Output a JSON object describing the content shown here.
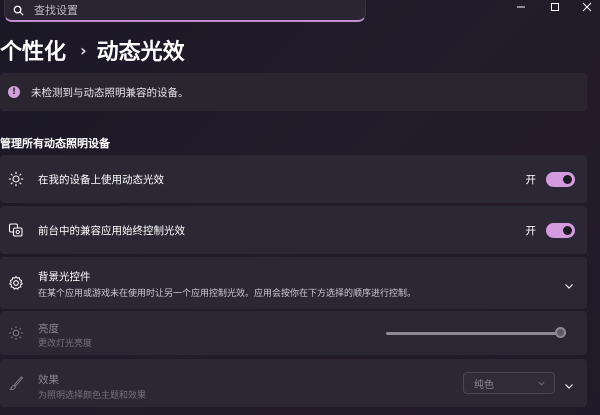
{
  "search": {
    "placeholder": "查找设置"
  },
  "breadcrumb": {
    "parent": "个性化",
    "separator": "›",
    "current": "动态光效"
  },
  "info": {
    "message": "未检测到与动态照明兼容的设备。"
  },
  "section": {
    "title": "管理所有动态照明设备"
  },
  "settings": {
    "use_on_device": {
      "label": "在我的设备上使用动态光效",
      "state": "开",
      "on": true
    },
    "foreground_control": {
      "label": "前台中的兼容应用始终控制光效",
      "state": "开",
      "on": true
    },
    "background_control": {
      "label": "背景光控件",
      "description": "在某个应用或游戏未在使用时让另一个应用控制光效。应用会按你在下方选择的顺序进行控制。"
    },
    "brightness": {
      "label": "亮度",
      "description": "更改灯光亮度",
      "value_percent": 100
    },
    "effects": {
      "label": "效果",
      "description": "为照明选择颜色主题和效果",
      "selected": "纯色"
    }
  },
  "colors": {
    "accent": "#d49bde",
    "background": "#1f1a29",
    "card": "#2c2836"
  },
  "icons": {
    "search": "search-icon",
    "minimize": "minimize-icon",
    "maximize": "maximize-icon",
    "close": "close-icon",
    "info": "info-icon",
    "sun": "sun-icon",
    "devices": "devices-icon",
    "gear": "gear-icon",
    "brightness": "brightness-icon",
    "brush": "brush-icon",
    "chevron": "chevron-down-icon"
  }
}
